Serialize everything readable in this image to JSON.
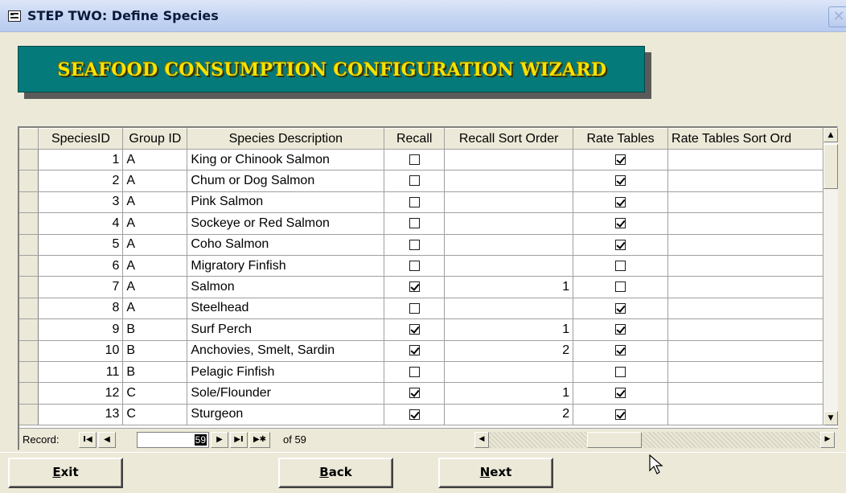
{
  "window": {
    "title": "STEP TWO:  Define Species",
    "close_glyph": "✕"
  },
  "banner": {
    "text": "SEAFOOD CONSUMPTION CONFIGURATION WIZARD",
    "bg_color": "#047a7a",
    "text_color": "#f5e300"
  },
  "table": {
    "columns": [
      "SpeciesID",
      "Group ID",
      "Species Description",
      "Recall",
      "Recall Sort Order",
      "Rate Tables",
      "Rate Tables Sort Ord"
    ],
    "rows": [
      {
        "id": "1",
        "group": "A",
        "desc": "King or Chinook Salmon",
        "recall": false,
        "recall_sort": "",
        "rate": true
      },
      {
        "id": "2",
        "group": "A",
        "desc": "Chum or Dog Salmon",
        "recall": false,
        "recall_sort": "",
        "rate": true
      },
      {
        "id": "3",
        "group": "A",
        "desc": "Pink Salmon",
        "recall": false,
        "recall_sort": "",
        "rate": true
      },
      {
        "id": "4",
        "group": "A",
        "desc": "Sockeye or Red Salmon",
        "recall": false,
        "recall_sort": "",
        "rate": true
      },
      {
        "id": "5",
        "group": "A",
        "desc": "Coho Salmon",
        "recall": false,
        "recall_sort": "",
        "rate": true
      },
      {
        "id": "6",
        "group": "A",
        "desc": "Migratory Finfish",
        "recall": false,
        "recall_sort": "",
        "rate": false
      },
      {
        "id": "7",
        "group": "A",
        "desc": "Salmon",
        "recall": true,
        "recall_sort": "1",
        "rate": false
      },
      {
        "id": "8",
        "group": "A",
        "desc": "Steelhead",
        "recall": false,
        "recall_sort": "",
        "rate": true
      },
      {
        "id": "9",
        "group": "B",
        "desc": "Surf Perch",
        "recall": true,
        "recall_sort": "1",
        "rate": true
      },
      {
        "id": "10",
        "group": "B",
        "desc": "Anchovies, Smelt, Sardin",
        "recall": true,
        "recall_sort": "2",
        "rate": true
      },
      {
        "id": "11",
        "group": "B",
        "desc": "Pelagic Finfish",
        "recall": false,
        "recall_sort": "",
        "rate": false
      },
      {
        "id": "12",
        "group": "C",
        "desc": "Sole/Flounder",
        "recall": true,
        "recall_sort": "1",
        "rate": true
      },
      {
        "id": "13",
        "group": "C",
        "desc": "Sturgeon",
        "recall": true,
        "recall_sort": "2",
        "rate": true
      }
    ]
  },
  "navigator": {
    "label": "Record:",
    "current": "59",
    "of_text": "of 59",
    "first_glyph": "I◀",
    "prev_glyph": "◀",
    "next_glyph": "▶",
    "last_glyph": "▶I",
    "new_glyph": "▶✱"
  },
  "scroll_glyphs": {
    "up": "▲",
    "down": "▼",
    "left": "◀",
    "right": "▶"
  },
  "buttons": {
    "exit_underline": "E",
    "exit_rest": "xit",
    "back_underline": "B",
    "back_rest": "ack",
    "next_underline": "N",
    "next_rest": "ext"
  }
}
